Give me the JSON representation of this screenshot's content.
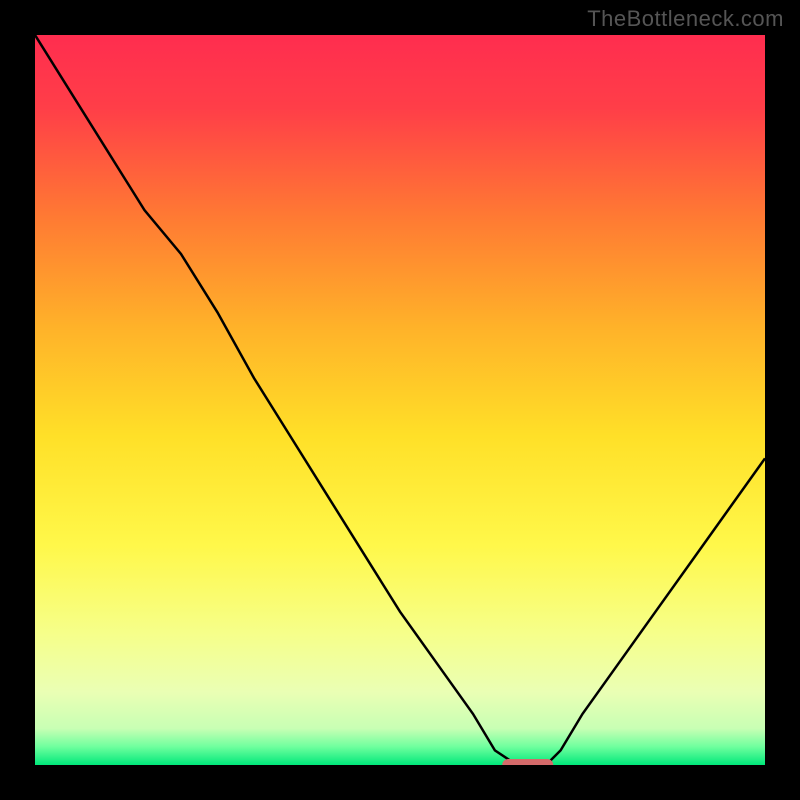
{
  "branding": {
    "watermark": "TheBottleneck.com"
  },
  "chart_data": {
    "type": "line",
    "title": "",
    "xlabel": "",
    "ylabel": "",
    "xlim": [
      0,
      100
    ],
    "ylim": [
      0,
      100
    ],
    "grid": false,
    "series": [
      {
        "name": "bottleneck-curve",
        "x": [
          0,
          5,
          10,
          15,
          20,
          25,
          30,
          35,
          40,
          45,
          50,
          55,
          60,
          63,
          66,
          70,
          72,
          75,
          80,
          85,
          90,
          95,
          100
        ],
        "y": [
          100,
          92,
          84,
          76,
          70,
          62,
          53,
          45,
          37,
          29,
          21,
          14,
          7,
          2,
          0,
          0,
          2,
          7,
          14,
          21,
          28,
          35,
          42
        ]
      }
    ],
    "marker": {
      "name": "optimal-range-marker",
      "x_start": 64,
      "x_end": 71,
      "y": 0,
      "color": "#d46a6a"
    },
    "gradient_stops": [
      {
        "offset": 0.0,
        "color": "#ff2d4f"
      },
      {
        "offset": 0.1,
        "color": "#ff3e48"
      },
      {
        "offset": 0.25,
        "color": "#ff7a33"
      },
      {
        "offset": 0.4,
        "color": "#ffb229"
      },
      {
        "offset": 0.55,
        "color": "#ffe028"
      },
      {
        "offset": 0.7,
        "color": "#fff84a"
      },
      {
        "offset": 0.82,
        "color": "#f6ff8a"
      },
      {
        "offset": 0.9,
        "color": "#eaffb4"
      },
      {
        "offset": 0.95,
        "color": "#c8ffb4"
      },
      {
        "offset": 0.975,
        "color": "#6fff9e"
      },
      {
        "offset": 1.0,
        "color": "#00e87a"
      }
    ]
  }
}
